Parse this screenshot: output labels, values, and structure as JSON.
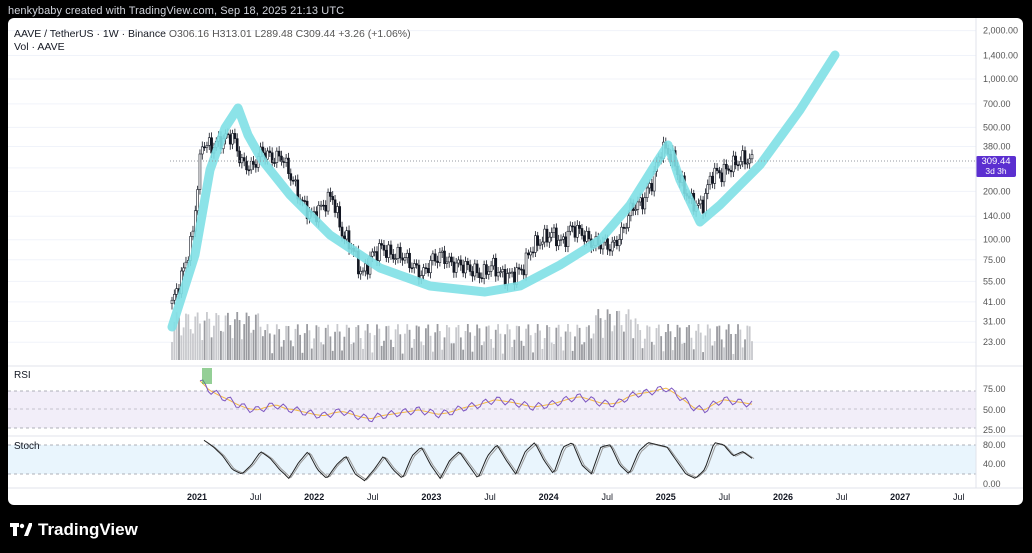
{
  "header": {
    "creator_line": "henkybaby created with TradingView.com, Sep 18, 2025 21:13 UTC"
  },
  "legend": {
    "symbol": "AAVE / TetherUS · 1W · Binance",
    "open_label": "O",
    "open": "306.16",
    "high_label": "H",
    "high": "313.01",
    "low_label": "L",
    "low": "289.48",
    "close_label": "C",
    "close": "309.44",
    "change": "+3.26 (+1.06%)",
    "vol_label": "Vol · AAVE"
  },
  "price_axis": {
    "ticks": [
      "2,000.00",
      "1,400.00",
      "1,000.00",
      "700.00",
      "500.00",
      "380.00",
      "280.00",
      "200.00",
      "140.00",
      "100.00",
      "75.00",
      "55.00",
      "41.00",
      "31.00",
      "23.00"
    ],
    "last_price": "309.44",
    "countdown": "3d 3h",
    "last_color": "#5b2fd0"
  },
  "time_axis": {
    "labels": [
      "2021",
      "Jul",
      "2022",
      "Jul",
      "2023",
      "Jul",
      "2024",
      "Jul",
      "2025",
      "Jul",
      "2026",
      "Jul",
      "2027",
      "Jul"
    ]
  },
  "rsi": {
    "label": "RSI",
    "ticks": [
      "75.00",
      "50.00",
      "25.00"
    ]
  },
  "stoch": {
    "label": "Stoch",
    "ticks": [
      "80.00",
      "40.00",
      "0.00"
    ]
  },
  "footer": {
    "brand": "TradingView"
  },
  "chart_data": [
    {
      "type": "line",
      "title": "AAVE / TetherUS · 1W · Binance",
      "scale": "log",
      "ylim": [
        20,
        2200
      ],
      "x": [
        "2020-11",
        "2020-12",
        "2021-01",
        "2021-02",
        "2021-03",
        "2021-04",
        "2021-05",
        "2021-06",
        "2021-07",
        "2021-08",
        "2021-09",
        "2021-10",
        "2021-11",
        "2021-12",
        "2022-01",
        "2022-02",
        "2022-03",
        "2022-04",
        "2022-05",
        "2022-06",
        "2022-07",
        "2022-08",
        "2022-09",
        "2022-10",
        "2022-11",
        "2022-12",
        "2023-01",
        "2023-02",
        "2023-03",
        "2023-04",
        "2023-05",
        "2023-06",
        "2023-07",
        "2023-08",
        "2023-09",
        "2023-10",
        "2023-11",
        "2023-12",
        "2024-01",
        "2024-02",
        "2024-03",
        "2024-04",
        "2024-05",
        "2024-06",
        "2024-07",
        "2024-08",
        "2024-09",
        "2024-10",
        "2024-11",
        "2024-12",
        "2025-01",
        "2025-02",
        "2025-03",
        "2025-04",
        "2025-05",
        "2025-06",
        "2025-07",
        "2025-08",
        "2025-09"
      ],
      "series": [
        {
          "values": [
            40,
            60,
            100,
            400,
            380,
            420,
            450,
            300,
            280,
            360,
            320,
            330,
            240,
            170,
            140,
            160,
            190,
            110,
            90,
            60,
            80,
            90,
            80,
            80,
            70,
            60,
            75,
            80,
            70,
            70,
            65,
            60,
            70,
            60,
            60,
            65,
            90,
            100,
            110,
            95,
            120,
            110,
            95,
            95,
            90,
            110,
            160,
            170,
            230,
            380,
            330,
            220,
            170,
            160,
            260,
            260,
            290,
            320,
            309.44
          ]
        }
      ],
      "annotations": [
        "cup and handle projection curve"
      ]
    },
    {
      "type": "line",
      "title": "RSI",
      "ylim": [
        0,
        100
      ],
      "ticks": [
        25,
        50,
        75
      ],
      "series": [
        {
          "values": [
            88,
            75,
            68,
            62,
            55,
            50,
            48,
            52,
            55,
            50,
            48,
            45,
            42,
            40,
            44,
            46,
            42,
            38,
            36,
            40,
            42,
            44,
            46,
            48,
            45,
            42,
            44,
            48,
            52,
            54,
            58,
            62,
            60,
            58,
            55,
            52,
            54,
            56,
            60,
            64,
            66,
            62,
            58,
            56,
            58,
            66,
            70,
            72,
            75,
            78,
            70,
            60,
            50,
            48,
            56,
            62,
            60,
            58,
            56
          ]
        }
      ]
    },
    {
      "type": "line",
      "title": "Stoch",
      "ylim": [
        0,
        100
      ],
      "ticks": [
        0,
        40,
        80
      ],
      "series": [
        {
          "values": [
            95,
            80,
            60,
            30,
            20,
            40,
            70,
            55,
            30,
            10,
            45,
            70,
            30,
            10,
            40,
            60,
            20,
            5,
            30,
            60,
            30,
            10,
            60,
            80,
            40,
            10,
            50,
            70,
            40,
            10,
            60,
            85,
            50,
            20,
            70,
            90,
            50,
            20,
            80,
            90,
            40,
            20,
            80,
            85,
            40,
            20,
            70,
            90,
            85,
            80,
            50,
            20,
            10,
            30,
            90,
            85,
            60,
            70,
            55
          ]
        }
      ]
    }
  ]
}
